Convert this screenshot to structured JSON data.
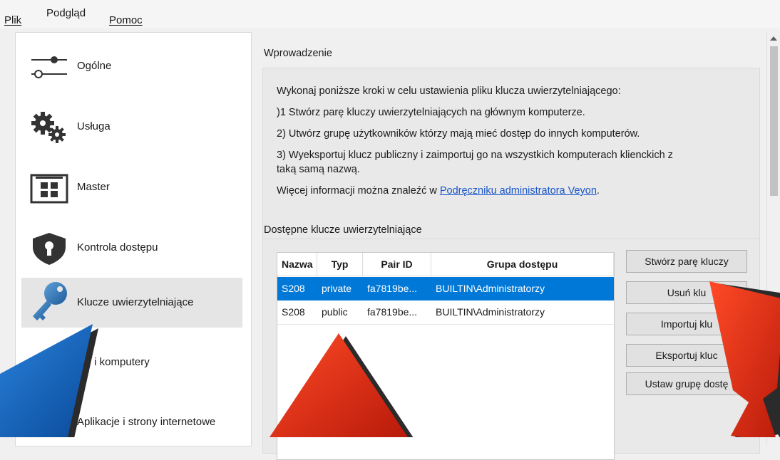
{
  "menu": {
    "file": "Plik",
    "view": "Podgląd",
    "help": "Pomoc"
  },
  "sidebar": {
    "items": [
      {
        "label": "Ogólne",
        "icon": "sliders-icon"
      },
      {
        "label": "Usługa",
        "icon": "gears-icon"
      },
      {
        "label": "Master",
        "icon": "grid-window-icon"
      },
      {
        "label": "Kontrola dostępu",
        "icon": "shield-keyhole-icon"
      },
      {
        "label": "Klucze uwierzytelniające",
        "icon": "key-icon",
        "selected": true
      },
      {
        "label": "ale i komputery",
        "icon": "classroom-icon"
      },
      {
        "label": "Aplikacje i strony internetowe",
        "icon": "apps-icon"
      }
    ]
  },
  "intro": {
    "title": "Wprowadzenie",
    "lines": [
      "Wykonaj poniższe kroki w celu ustawienia pliku klucza uwierzytelniającego:",
      ")1 Stwórz parę kluczy uwierzytelniających na głównym komputerze.",
      "2) Utwórz grupę użytkowników którzy mają mieć dostęp do innych komputerów.",
      "3) Wyeksportuj klucz publiczny i zaimportuj go na wszystkich komputerach klienckich z",
      "taką samą nazwą."
    ],
    "more_prefix": "Więcej informacji można znaleźć w ",
    "more_link": "Podręczniku administratora Veyon",
    "more_suffix": "."
  },
  "keys": {
    "title": "Dostępne klucze uwierzytelniające",
    "columns": [
      "Nazwa",
      "Typ",
      "Pair ID",
      "Grupa dostępu"
    ],
    "rows": [
      [
        "S208",
        "private",
        "fa7819be...",
        "BUILTIN\\Administratorzy"
      ],
      [
        "S208",
        "public",
        "fa7819be...",
        "BUILTIN\\Administratorzy"
      ]
    ],
    "selected_row": 0,
    "buttons": {
      "create": "Stwórz parę kluczy",
      "delete": "Usuń klu",
      "import": "Importuj klu",
      "export": "Eksportuj kluc",
      "set_group": "Ustaw grupę dostę"
    }
  },
  "colors": {
    "selection": "#0078d7",
    "link": "#1a55c8",
    "arrow_red": "#e8301a",
    "arrow_blue": "#1464c8"
  }
}
